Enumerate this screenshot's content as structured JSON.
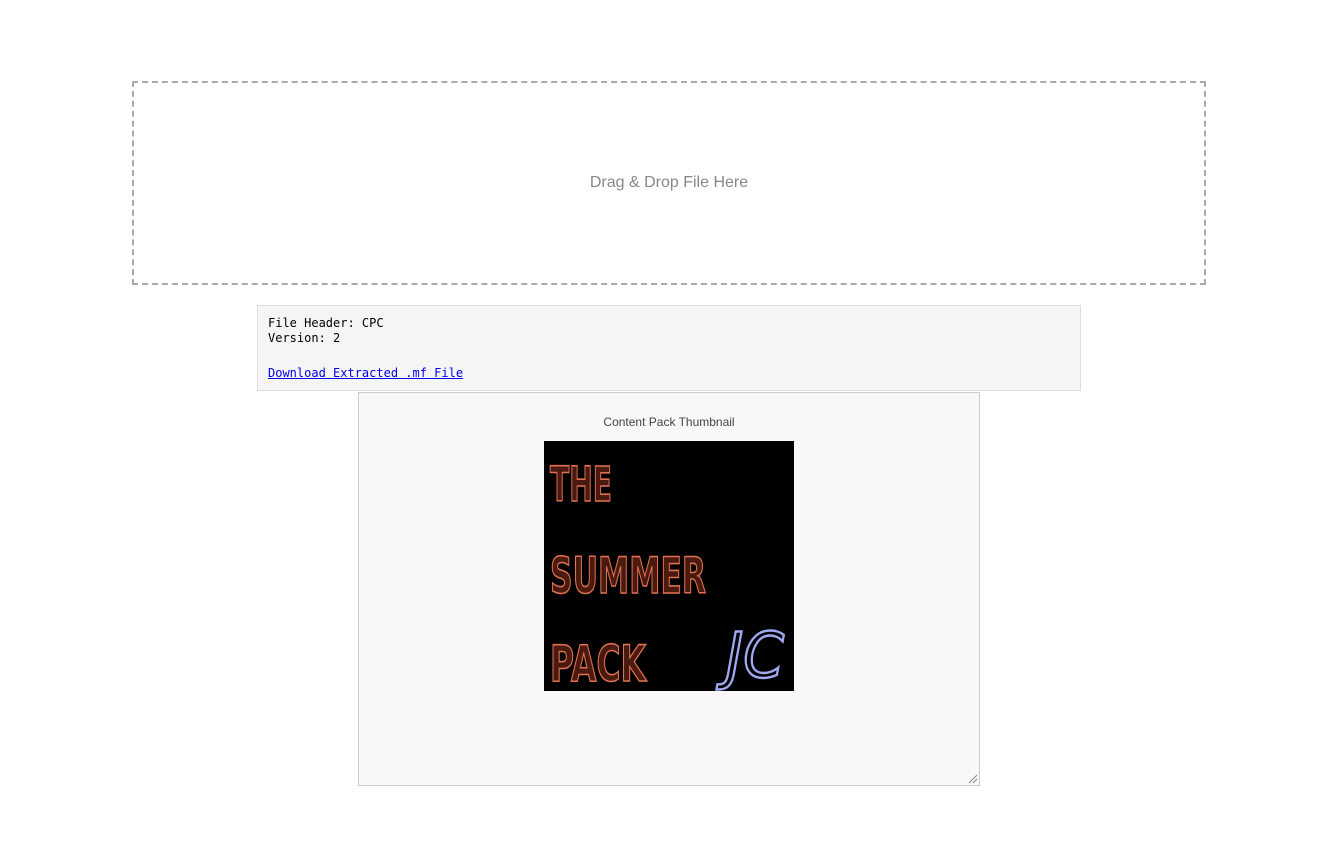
{
  "drop_zone": {
    "label": "Drag & Drop File Here"
  },
  "file_info": {
    "header_line": "File Header: CPC",
    "version_line": "Version: 2",
    "download_link": "Download Extracted .mf File"
  },
  "thumbnail": {
    "title": "Content Pack Thumbnail",
    "image_text": {
      "line1": "THE",
      "line2": "SUMMER",
      "line3": "PACK",
      "logo": "JC"
    },
    "colors": {
      "background": "#000000",
      "text_fill": "#4a1a10",
      "text_outline": "#e07050",
      "logo": "#a0a8f0"
    }
  }
}
